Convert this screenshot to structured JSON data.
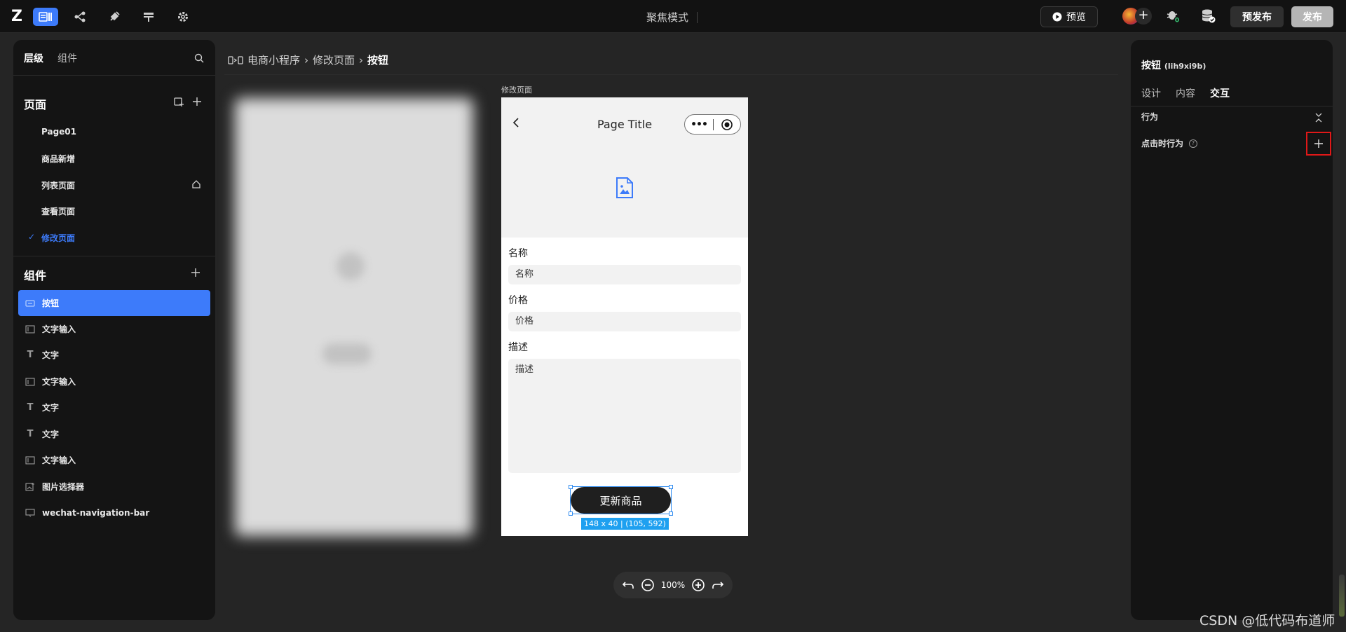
{
  "topbar": {
    "logo": "Z",
    "mode_title": "聚焦模式",
    "preview_label": "预览",
    "pre_publish_label": "预发布",
    "publish_label": "发布",
    "accent": "#3d7bfa"
  },
  "left_panel": {
    "tabs": [
      "层级",
      "组件"
    ],
    "pages_title": "页面",
    "pages": [
      "Page01",
      "商品新增",
      "列表页面",
      "查看页面",
      "修改页面"
    ],
    "active_page": "修改页面",
    "components_title": "组件",
    "components": [
      {
        "label": "按钮",
        "icon": "button-icon",
        "active": true
      },
      {
        "label": "文字输入",
        "icon": "text-input-icon"
      },
      {
        "label": "文字",
        "icon": "text-icon"
      },
      {
        "label": "文字输入",
        "icon": "text-input-icon"
      },
      {
        "label": "文字",
        "icon": "text-icon"
      },
      {
        "label": "文字",
        "icon": "text-icon"
      },
      {
        "label": "文字输入",
        "icon": "text-input-icon"
      },
      {
        "label": "图片选择器",
        "icon": "image-picker-icon"
      },
      {
        "label": "wechat-navigation-bar",
        "icon": "nav-bar-icon"
      }
    ]
  },
  "breadcrumb": {
    "items": [
      "电商小程序",
      "修改页面",
      "按钮"
    ],
    "separator": "›"
  },
  "canvas": {
    "page_label": "修改页面",
    "phone_title": "Page Title",
    "capsule_more": "•••",
    "fields": [
      {
        "label": "名称",
        "placeholder": "名称"
      },
      {
        "label": "价格",
        "placeholder": "价格"
      },
      {
        "label": "描述",
        "placeholder": "描述"
      }
    ],
    "button_label": "更新商品",
    "size_tag": "148 x 40 | (105, 592)",
    "zoom": "100%"
  },
  "right_panel": {
    "title": "按钮",
    "element_id": "(lih9xi9b)",
    "tabs": [
      "设计",
      "内容",
      "交互"
    ],
    "active_tab": "交互",
    "section": "行为",
    "click_behavior_label": "点击时行为",
    "help": "?"
  },
  "watermark": "CSDN @低代码布道师"
}
